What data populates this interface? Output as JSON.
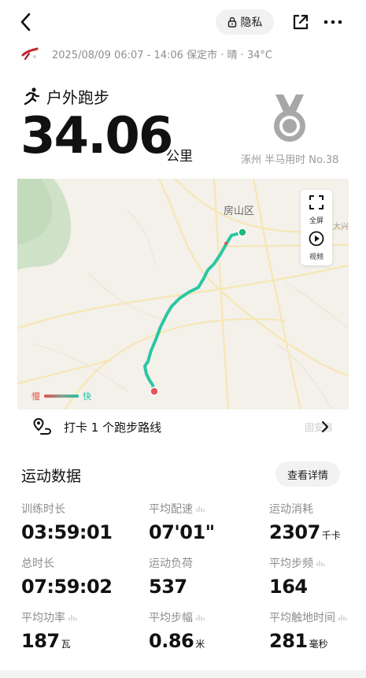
{
  "topbar": {
    "privacy_label": "隐私"
  },
  "meta": {
    "datetime_location": "2025/08/09 06:07 - 14:06 保定市 · 晴 · 34°C"
  },
  "activity": {
    "name": "户外跑步",
    "distance": "34.06",
    "distance_unit": "公里"
  },
  "medal": {
    "caption": "涿州 半马用时 No.38"
  },
  "map": {
    "district_label": "房山区",
    "edge_label": "大兴",
    "fullscreen_label": "全屏",
    "video_label": "视频",
    "legend_slow": "慢",
    "legend_fast": "快",
    "route_prompt": "打卡 1 个跑步路线",
    "route_faded_label": "固安县",
    "colors": {
      "route": "#2cc6a4",
      "start": "#1fb87f",
      "end": "#e5545a"
    }
  },
  "stats": {
    "section_title": "运动数据",
    "details_button": "查看详情",
    "items": [
      {
        "label": "训练时长",
        "value": "03:59:01",
        "unit": ""
      },
      {
        "label": "平均配速",
        "value": "07'01\"",
        "unit": ""
      },
      {
        "label": "运动消耗",
        "value": "2307",
        "unit": "千卡"
      },
      {
        "label": "总时长",
        "value": "07:59:02",
        "unit": ""
      },
      {
        "label": "运动负荷",
        "value": "537",
        "unit": ""
      },
      {
        "label": "平均步频",
        "value": "164",
        "unit": ""
      },
      {
        "label": "平均功率",
        "value": "187",
        "unit": "瓦"
      },
      {
        "label": "平均步幅",
        "value": "0.86",
        "unit": "米"
      },
      {
        "label": "平均触地时间",
        "value": "281",
        "unit": "毫秒"
      }
    ]
  }
}
